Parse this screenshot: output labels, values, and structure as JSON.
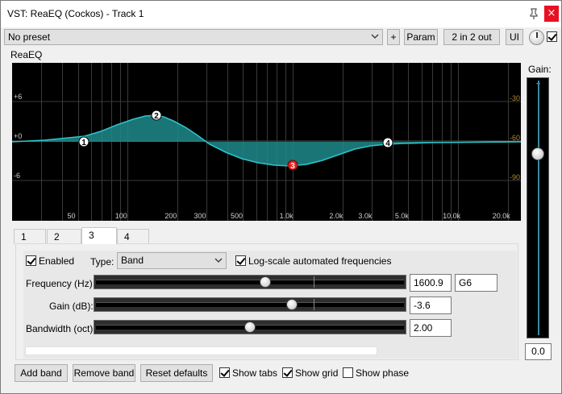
{
  "window": {
    "title": "VST: ReaEQ (Cockos) - Track 1",
    "close_label": "×"
  },
  "toolbar": {
    "preset": "No preset",
    "plus_label": "+",
    "param_label": "Param",
    "io_label": "2 in 2 out",
    "ui_label": "UI"
  },
  "group_label": "ReaEQ",
  "graph": {
    "db_left": [
      "+6",
      "+0",
      "-6"
    ],
    "db_right": [
      "-30",
      "-60",
      "-90"
    ],
    "freq_labels": [
      "50",
      "100",
      "200",
      "300",
      "500",
      "1.0k",
      "2.0k",
      "3.0k",
      "5.0k",
      "10.0k",
      "20.0k"
    ],
    "band_nodes": [
      "1",
      "2",
      "3",
      "4"
    ],
    "curve_color": "#2ec4c9",
    "fill_color": "#1f8a8c",
    "selected_node_color": "#e02020"
  },
  "gain": {
    "label": "Gain:",
    "value": "0.0",
    "tick": "+"
  },
  "tabs": [
    "1",
    "2",
    "3",
    "4"
  ],
  "band": {
    "enabled_label": "Enabled",
    "type_label": "Type:",
    "type_value": "Band",
    "logscale_label": "Log-scale automated frequencies",
    "frequency_label": "Frequency (Hz):",
    "frequency_value": "1600.9",
    "note_value": "G6",
    "gain_label": "Gain (dB):",
    "gain_value": "-3.6",
    "bandwidth_label": "Bandwidth (oct):",
    "bandwidth_value": "2.00"
  },
  "bottom": {
    "add_band": "Add band",
    "remove_band": "Remove band",
    "reset_defaults": "Reset defaults",
    "show_tabs": "Show tabs",
    "show_grid": "Show grid",
    "show_phase": "Show phase"
  }
}
